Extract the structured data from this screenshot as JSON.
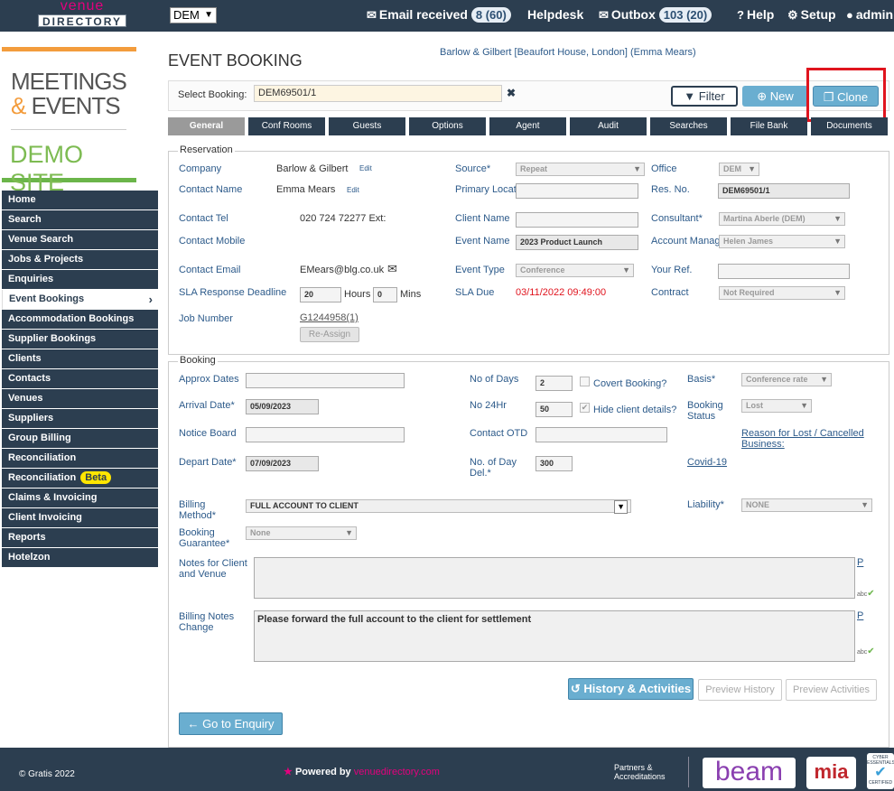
{
  "topbar": {
    "logo_line1": "venue",
    "logo_line2": "DIRECTORY",
    "office_select": "DEM",
    "email_received_label": "Email received",
    "email_received_count": "8 (60)",
    "helpdesk_label": "Helpdesk",
    "outbox_label": "Outbox",
    "outbox_count": "103 (20)",
    "help_label": "Help",
    "setup_label": "Setup",
    "admin_label": "admin"
  },
  "brand": {
    "line1": "MEETINGS",
    "amp": "&",
    "line2": "EVENTS",
    "line3": "DEMO SITE"
  },
  "sidebar": {
    "items": [
      {
        "label": "Home"
      },
      {
        "label": "Search"
      },
      {
        "label": "Venue Search"
      },
      {
        "label": "Jobs & Projects"
      },
      {
        "label": "Enquiries"
      },
      {
        "label": "Event Bookings"
      },
      {
        "label": "Accommodation Bookings"
      },
      {
        "label": "Supplier Bookings"
      },
      {
        "label": "Clients"
      },
      {
        "label": "Contacts"
      },
      {
        "label": "Venues"
      },
      {
        "label": "Suppliers"
      },
      {
        "label": "Group Billing"
      },
      {
        "label": "Reconciliation"
      },
      {
        "label": "Reconciliation"
      },
      {
        "label": "Claims & Invoicing"
      },
      {
        "label": "Client Invoicing"
      },
      {
        "label": "Reports"
      },
      {
        "label": "Hotelzon"
      }
    ],
    "beta_badge": "Beta"
  },
  "header": {
    "page_title": "EVENT BOOKING",
    "company_link": "Barlow & Gilbert [Beaufort House, London] (Emma Mears)",
    "select_booking_label": "Select Booking:",
    "select_booking_value": "DEM69501/1",
    "filter_label": "Filter",
    "new_label": "New",
    "clone_label": "Clone"
  },
  "tabs": [
    "General",
    "Conf Rooms",
    "Guests",
    "Options",
    "Agent",
    "Audit",
    "Searches",
    "File Bank",
    "Documents"
  ],
  "reservation": {
    "legend": "Reservation",
    "company_label": "Company",
    "company_value": "Barlow & Gilbert",
    "edit": "Edit",
    "contact_name_label": "Contact Name",
    "contact_name_value": "Emma Mears",
    "contact_tel_label": "Contact Tel",
    "contact_tel_value": "020 724 72277 Ext:",
    "contact_mobile_label": "Contact Mobile",
    "contact_email_label": "Contact Email",
    "contact_email_value": "EMears@blg.co.uk",
    "sla_deadline_label": "SLA Response Deadline",
    "sla_hours_value": "20",
    "hours_label": "Hours",
    "sla_mins_value": "0",
    "mins_label": "Mins",
    "job_number_label": "Job Number",
    "job_number_value": "G1244958(1)",
    "reassign_label": "Re-Assign",
    "source_label": "Source*",
    "source_value": "Repeat",
    "primary_location_label": "Primary Location",
    "client_name_label": "Client Name",
    "event_name_label": "Event Name",
    "event_name_value": "2023 Product Launch",
    "event_type_label": "Event Type",
    "event_type_value": "Conference",
    "sla_due_label": "SLA Due",
    "sla_due_value": "03/11/2022 09:49:00",
    "office_label": "Office",
    "office_value": "DEM",
    "res_no_label": "Res. No.",
    "res_no_value": "DEM69501/1",
    "consultant_label": "Consultant*",
    "consultant_value": "Martina Aberle (DEM)",
    "account_manager_label": "Account Manager",
    "account_manager_value": "Helen James",
    "your_ref_label": "Your Ref.",
    "contract_label": "Contract",
    "contract_value": "Not Required"
  },
  "booking": {
    "legend": "Booking",
    "approx_dates_label": "Approx Dates",
    "arrival_label": "Arrival Date*",
    "arrival_value": "05/09/2023",
    "notice_board_label": "Notice Board",
    "depart_label": "Depart Date*",
    "depart_value": "07/09/2023",
    "no_of_days_label": "No of Days",
    "no_of_days_value": "2",
    "covert_label": "Covert Booking?",
    "no_24hr_label": "No 24Hr",
    "no_24hr_value": "50",
    "hide_client_label": "Hide client details?",
    "contact_otd_label": "Contact OTD",
    "no_day_del_label": "No. of Day Del.*",
    "no_day_del_value": "300",
    "basis_label": "Basis*",
    "basis_value": "Conference rate",
    "booking_status_label": "Booking Status",
    "booking_status_value": "Lost",
    "reason_link": "Reason for Lost / Cancelled Business:",
    "covid_link": "Covid-19",
    "billing_method_label": "Billing Method*",
    "billing_method_value": "FULL ACCOUNT TO CLIENT",
    "liability_label": "Liability*",
    "liability_value": "NONE",
    "guarantee_label": "Booking Guarantee*",
    "guarantee_value": "None",
    "notes_label": "Notes for Client and Venue",
    "billing_notes_label": "Billing Notes Change",
    "billing_notes_value": "Please forward the full account to the client for settlement",
    "p_link": "P",
    "spell_label": "abc",
    "history_button": "History & Activities",
    "preview_history_button": "Preview History",
    "preview_activities_button": "Preview Activities",
    "go_enquiry_button": "Go to Enquiry"
  },
  "footer": {
    "copyright": "© Gratis 2022",
    "powered_by": "Powered by",
    "powered_brand": "venuedirectory.com",
    "partners_line1": "Partners &",
    "partners_line2": "Accreditations",
    "beam_logo": "beam",
    "mia_logo": "mia",
    "cyber_line1": "CYBER",
    "cyber_line2": "ESSENTIALS",
    "cyber_line3": "CERTIFIED"
  },
  "colors": {
    "navy": "#2c3e50",
    "accent_blue": "#6aaed0",
    "brand_pink": "#e3007d",
    "orange": "#f39c3c",
    "green": "#6bb54a",
    "highlight_red": "#e0141e"
  }
}
